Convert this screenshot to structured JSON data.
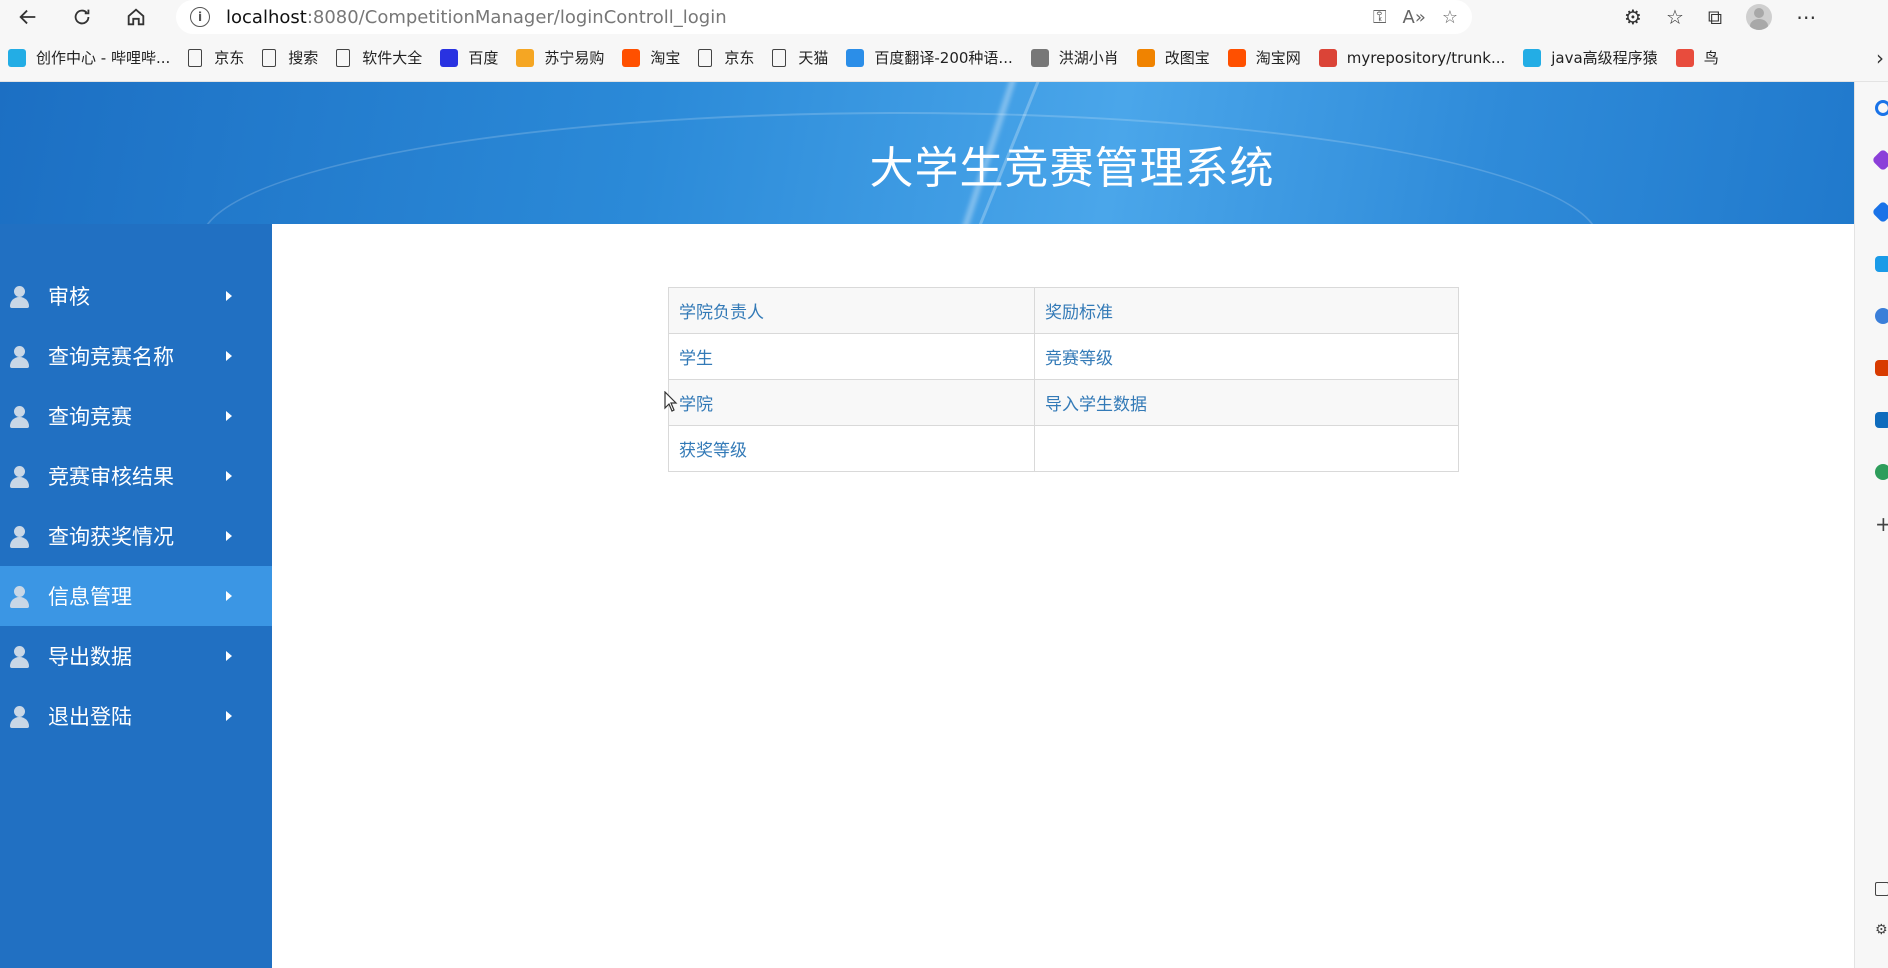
{
  "browser": {
    "url_host": "localhost",
    "url_rest": ":8080/CompetitionManager/loginControll_login",
    "bookmarks": [
      {
        "label": "创作中心 - 哔哩哔...",
        "icon": "bilibili-icon",
        "color": "#23ade5"
      },
      {
        "label": "京东",
        "icon": "page-icon"
      },
      {
        "label": "搜索",
        "icon": "page-icon"
      },
      {
        "label": "软件大全",
        "icon": "page-icon"
      },
      {
        "label": "百度",
        "icon": "baidu-icon",
        "color": "#2932e1"
      },
      {
        "label": "苏宁易购",
        "icon": "suning-icon",
        "color": "#f5a623"
      },
      {
        "label": "淘宝",
        "icon": "taobao-icon",
        "color": "#ff5000"
      },
      {
        "label": "京东",
        "icon": "page-icon"
      },
      {
        "label": "天猫",
        "icon": "page-icon"
      },
      {
        "label": "百度翻译-200种语...",
        "icon": "translate-icon",
        "color": "#2b8ee8"
      },
      {
        "label": "洪湖小肖",
        "icon": "bird-icon",
        "color": "#777777"
      },
      {
        "label": "改图宝",
        "icon": "gaitubao-icon",
        "color": "#f08300"
      },
      {
        "label": "淘宝网",
        "icon": "taobao-icon",
        "color": "#ff5000"
      },
      {
        "label": "myrepository/trunk...",
        "icon": "chrome-icon",
        "color": "#db4437"
      },
      {
        "label": "java高级程序猿",
        "icon": "bilibili-icon",
        "color": "#23ade5"
      },
      {
        "label": "鸟",
        "icon": "bird-icon",
        "color": "#e84c3d"
      }
    ]
  },
  "page": {
    "title": "大学生竞赛管理系统",
    "header_color": "#2b8ad8",
    "sidebar_color": "#2170c2",
    "active_color": "#3b96e4"
  },
  "sidebar": {
    "items": [
      {
        "label": "审核",
        "active": false
      },
      {
        "label": "查询竞赛名称",
        "active": false
      },
      {
        "label": "查询竞赛",
        "active": false
      },
      {
        "label": "竞赛审核结果",
        "active": false
      },
      {
        "label": "查询获奖情况",
        "active": false
      },
      {
        "label": "信息管理",
        "active": true
      },
      {
        "label": "导出数据",
        "active": false
      },
      {
        "label": "退出登陆",
        "active": false
      }
    ]
  },
  "links_table": {
    "rows": [
      [
        "学院负责人",
        "奖励标准"
      ],
      [
        "学生",
        "竞赛等级"
      ],
      [
        "学院",
        "导入学生数据"
      ],
      [
        "获奖等级",
        ""
      ]
    ]
  }
}
